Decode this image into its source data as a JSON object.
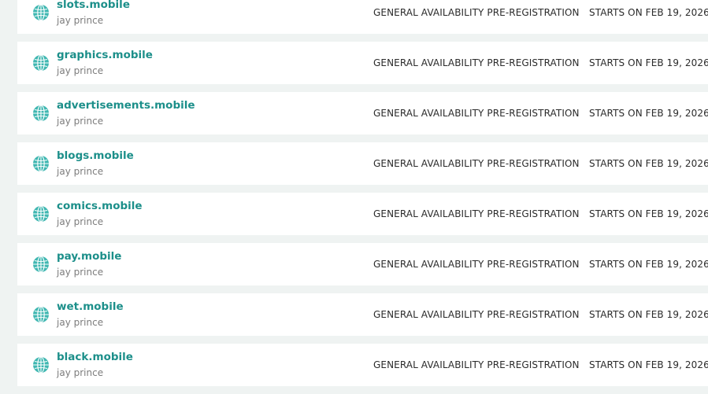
{
  "colors": {
    "accent": "#1c8f8a",
    "globe": "#3fb7b1",
    "background": "#eff3f2",
    "row": "#ffffff"
  },
  "domains": [
    {
      "name": "slots.mobile",
      "owner": "jay prince",
      "phase": "GENERAL AVAILABILITY PRE-REGISTRATION",
      "starts": "STARTS ON FEB 19, 2026",
      "icon": "globe-icon"
    },
    {
      "name": "graphics.mobile",
      "owner": "jay prince",
      "phase": "GENERAL AVAILABILITY PRE-REGISTRATION",
      "starts": "STARTS ON FEB 19, 2026",
      "icon": "globe-icon"
    },
    {
      "name": "advertisements.mobile",
      "owner": "jay prince",
      "phase": "GENERAL AVAILABILITY PRE-REGISTRATION",
      "starts": "STARTS ON FEB 19, 2026",
      "icon": "globe-icon"
    },
    {
      "name": "blogs.mobile",
      "owner": "jay prince",
      "phase": "GENERAL AVAILABILITY PRE-REGISTRATION",
      "starts": "STARTS ON FEB 19, 2026",
      "icon": "globe-icon"
    },
    {
      "name": "comics.mobile",
      "owner": "jay prince",
      "phase": "GENERAL AVAILABILITY PRE-REGISTRATION",
      "starts": "STARTS ON FEB 19, 2026",
      "icon": "globe-icon"
    },
    {
      "name": "pay.mobile",
      "owner": "jay prince",
      "phase": "GENERAL AVAILABILITY PRE-REGISTRATION",
      "starts": "STARTS ON FEB 19, 2026",
      "icon": "globe-icon"
    },
    {
      "name": "wet.mobile",
      "owner": "jay prince",
      "phase": "GENERAL AVAILABILITY PRE-REGISTRATION",
      "starts": "STARTS ON FEB 19, 2026",
      "icon": "globe-icon"
    },
    {
      "name": "black.mobile",
      "owner": "jay prince",
      "phase": "GENERAL AVAILABILITY PRE-REGISTRATION",
      "starts": "STARTS ON FEB 19, 2026",
      "icon": "globe-icon"
    }
  ]
}
